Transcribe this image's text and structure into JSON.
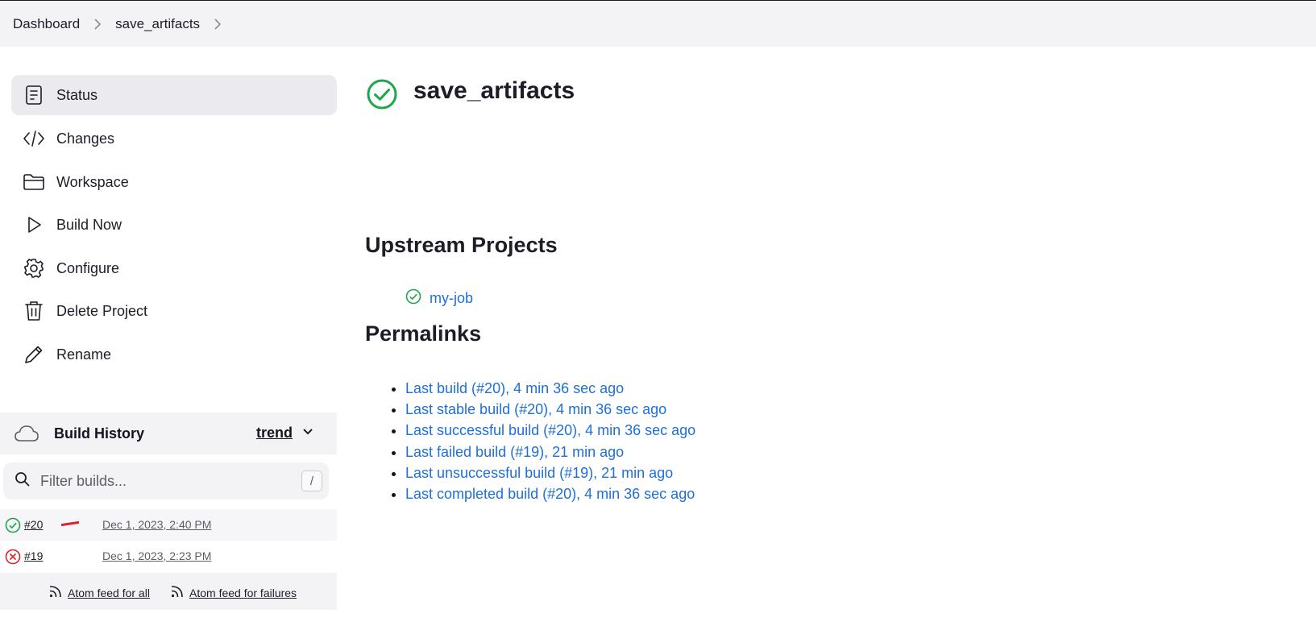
{
  "breadcrumbs": {
    "items": [
      "Dashboard",
      "save_artifacts"
    ]
  },
  "sidebar": {
    "items": [
      {
        "label": "Status",
        "icon": "status-icon",
        "active": true
      },
      {
        "label": "Changes",
        "icon": "code-icon"
      },
      {
        "label": "Workspace",
        "icon": "folder-icon"
      },
      {
        "label": "Build Now",
        "icon": "play-icon"
      },
      {
        "label": "Configure",
        "icon": "gear-icon"
      },
      {
        "label": "Delete Project",
        "icon": "trash-icon"
      },
      {
        "label": "Rename",
        "icon": "pencil-icon"
      }
    ]
  },
  "build_history": {
    "title": "Build History",
    "trend_label": "trend",
    "filter_placeholder": "Filter builds...",
    "filter_shortcut": "/",
    "builds": [
      {
        "number": "#20",
        "date": "Dec 1, 2023, 2:40 PM",
        "status": "success"
      },
      {
        "number": "#19",
        "date": "Dec 1, 2023, 2:23 PM",
        "status": "failed"
      }
    ],
    "feeds": {
      "all": "Atom feed for all",
      "failures": "Atom feed for failures"
    }
  },
  "main": {
    "title": "save_artifacts",
    "status": "success",
    "upstream": {
      "heading": "Upstream Projects",
      "projects": [
        {
          "name": "my-job",
          "status": "success"
        }
      ]
    },
    "permalinks": {
      "heading": "Permalinks",
      "items": [
        "Last build (#20), 4 min 36 sec ago",
        "Last stable build (#20), 4 min 36 sec ago",
        "Last successful build (#20), 4 min 36 sec ago",
        "Last failed build (#19), 21 min ago",
        "Last unsuccessful build (#19), 21 min ago",
        "Last completed build (#20), 4 min 36 sec ago"
      ]
    }
  },
  "colors": {
    "success": "#1ea64b",
    "failed": "#d9242e",
    "link": "#1e6fd9",
    "panel": "#f3f3f6"
  }
}
